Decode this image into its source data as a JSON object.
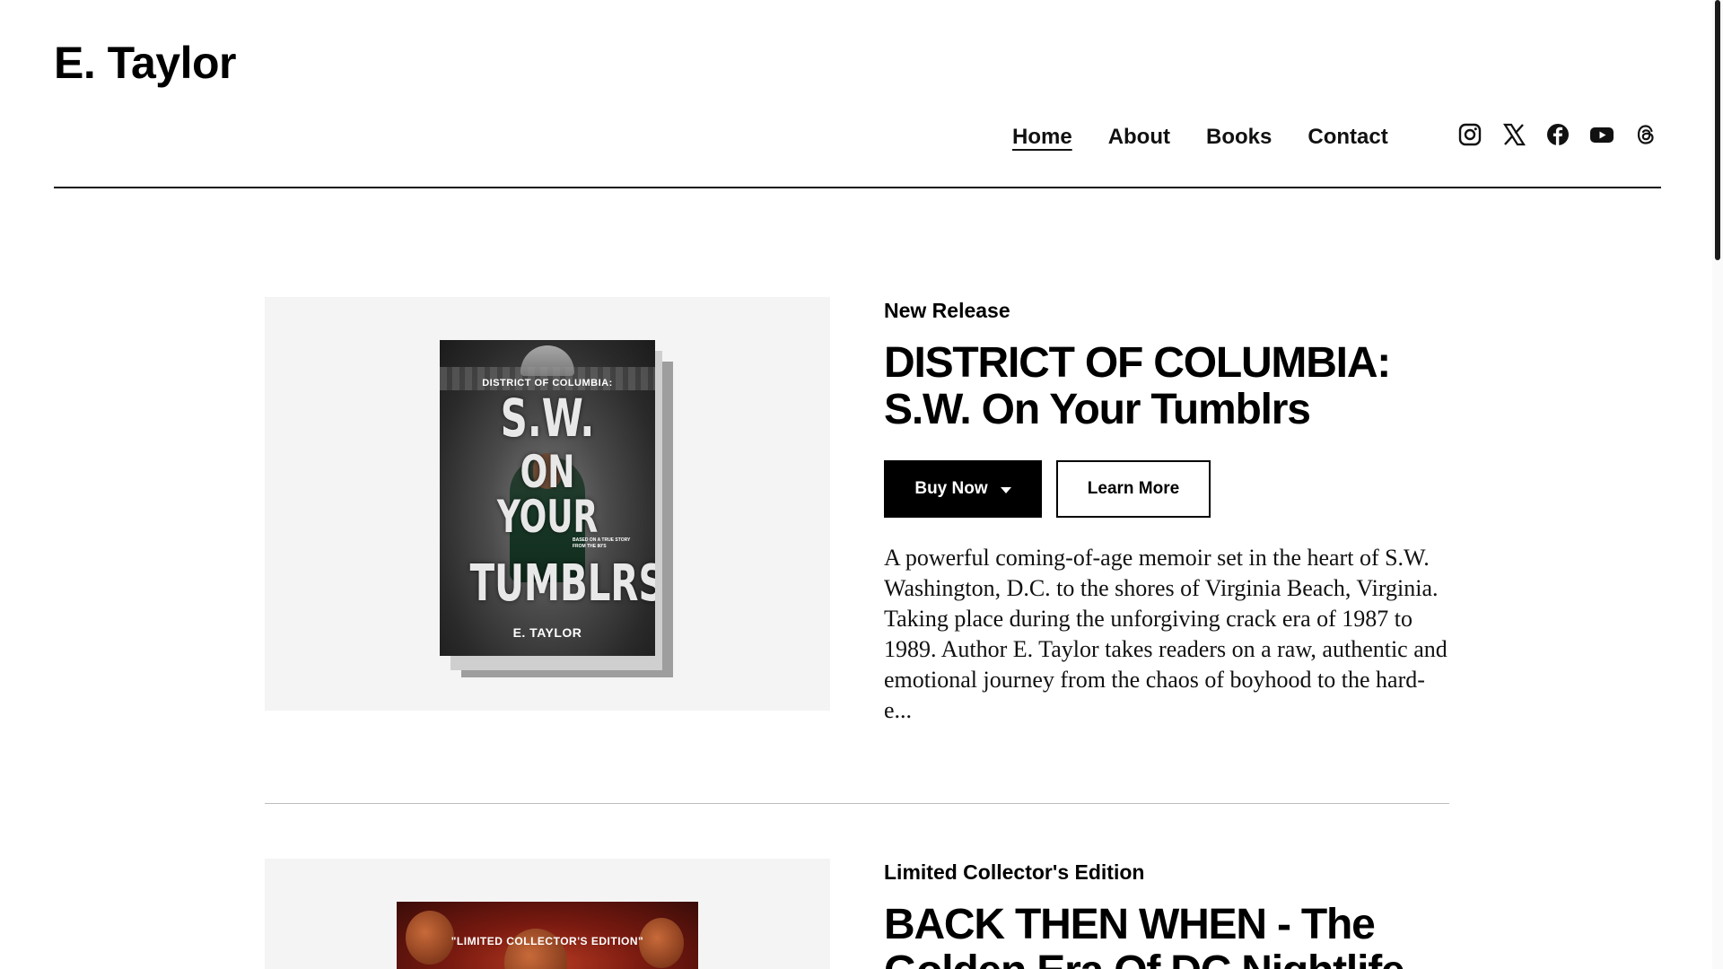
{
  "site": {
    "title": "E. Taylor"
  },
  "nav": {
    "items": [
      {
        "label": "Home",
        "active": true
      },
      {
        "label": "About",
        "active": false
      },
      {
        "label": "Books",
        "active": false
      },
      {
        "label": "Contact",
        "active": false
      }
    ]
  },
  "social": {
    "icons": [
      "instagram-icon",
      "x-icon",
      "facebook-icon",
      "youtube-icon",
      "threads-icon"
    ]
  },
  "books": [
    {
      "tagline": "New Release",
      "title_line1": "DISTRICT OF COLUMBIA:",
      "title_line2": "S.W. On Your Tumblrs",
      "buy_label": "Buy Now",
      "learn_label": "Learn More",
      "description": "A powerful coming-of-age memoir set in the heart of S.W. Washington, D.C. to the shores of Virginia Beach, Virginia. Taking place during the unforgiving crack era of 1987 to 1989. Author E. Taylor takes readers on a raw, authentic and emotional journey from the chaos of boyhood to the hard-e...",
      "cover": {
        "top_text": "DISTRICT OF COLUMBIA:",
        "line1": "S.W.",
        "line2": "ON YOUR",
        "line3": "TUMBLRS",
        "note": "BASED ON A TRUE STORY FROM THE 80'S",
        "author": "E. TAYLOR"
      }
    },
    {
      "tagline": "Limited Collector's Edition",
      "title_line1": "BACK THEN WHEN - The",
      "title_line2": "Golden Era Of DC Nightlife",
      "cover": {
        "label": "\"LIMITED COLLECTOR'S EDITION\""
      }
    }
  ],
  "colors": {
    "accent": "#000000",
    "cover_frame": "#f4f4f4",
    "divider": "#bdbdbd"
  }
}
